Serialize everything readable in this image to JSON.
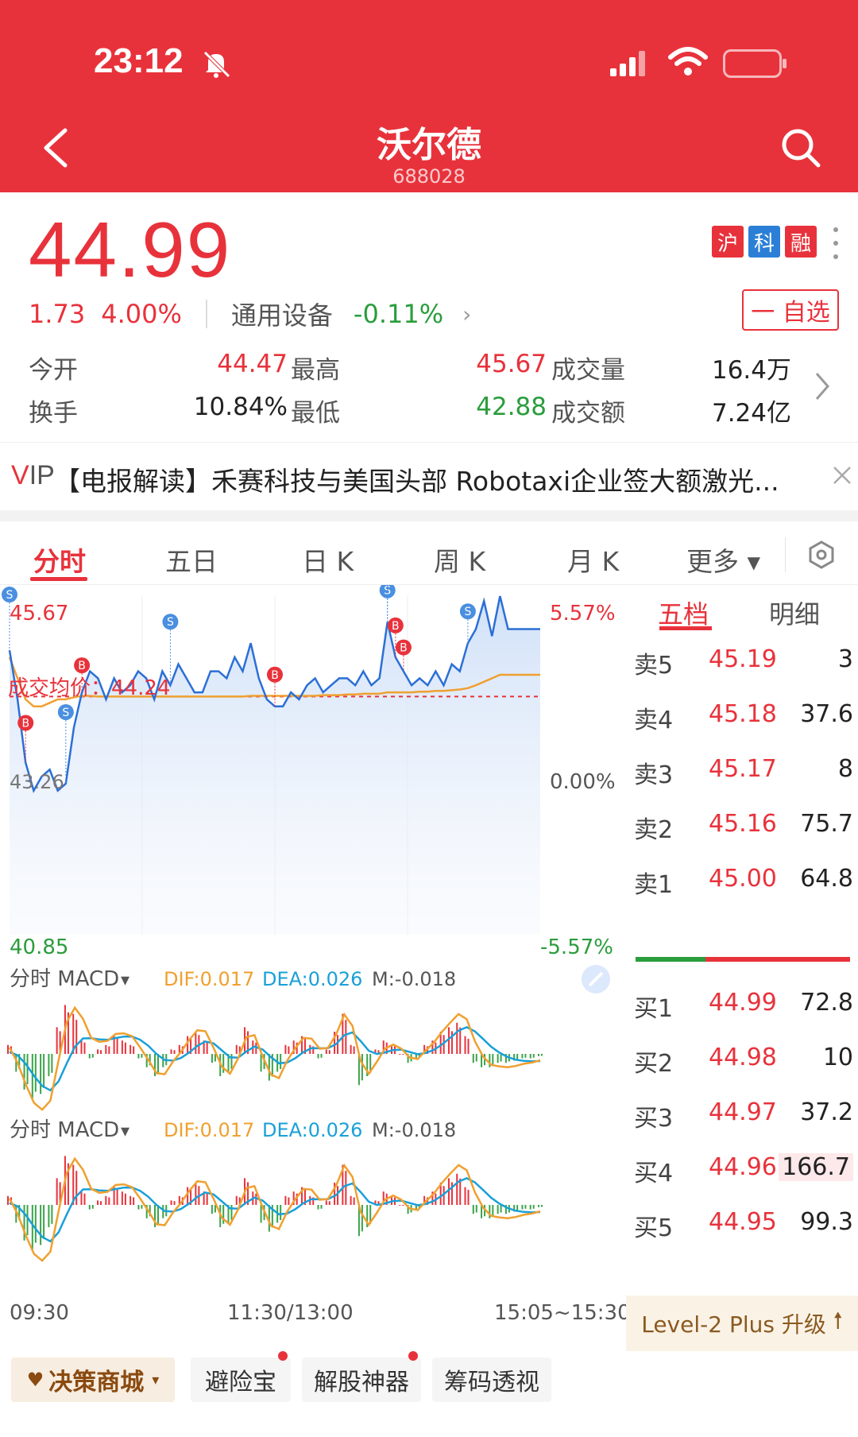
{
  "status_bar": {
    "time": "23:12"
  },
  "header": {
    "title": "沃尔德",
    "code": "688028"
  },
  "quote": {
    "price": "44.99",
    "change": "1.73",
    "change_pct": "4.00%",
    "badges": [
      "沪",
      "科",
      "融"
    ],
    "sector": "通用设备",
    "sector_change": "-0.11%",
    "watch_button": "一 自选"
  },
  "stats": [
    [
      {
        "label": "今开",
        "value": "44.47"
      },
      {
        "label": "最高",
        "value": "45.67"
      },
      {
        "label": "成交量",
        "value": "16.4万"
      }
    ],
    [
      {
        "label": "换手",
        "value": "10.84%"
      },
      {
        "label": "最低",
        "value": "42.88"
      },
      {
        "label": "成交额",
        "value": "7.24亿"
      }
    ]
  ],
  "news": {
    "prefix_v": "V",
    "prefix_ip": "IP",
    "text": "【电报解读】禾赛科技与美国头部 Robotaxi企业签大额激光..."
  },
  "tabs": [
    "分时",
    "五日",
    "日 K",
    "周 K",
    "月 K",
    "更多"
  ],
  "chart": {
    "price_high": "45.67",
    "price_low": "40.85",
    "pct_high": "5.57%",
    "pct_zero": "0.00%",
    "pct_low": "-5.57%",
    "prev_close_label": "43.26",
    "avg_label": "成交均价：44.24",
    "macd_title": "分时 MACD",
    "dif": "DIF:0.017",
    "dea": "DEA:0.026",
    "m": "M:-0.018",
    "time_start": "09:30",
    "time_mid": "11:30/13:00",
    "time_end": "15:05~15:30",
    "buy_marker": "B",
    "sell_marker": "S"
  },
  "chart_data": {
    "type": "line",
    "title": "分时",
    "ylim": [
      40.85,
      45.67
    ],
    "y_pct_range": [
      "-5.57%",
      "5.57%"
    ],
    "x_ticks": [
      "09:30",
      "11:30/13:00",
      "15:05~15:30"
    ],
    "series": [
      {
        "name": "price",
        "values": [
          44.9,
          44.2,
          43.3,
          42.9,
          43.1,
          43.2,
          42.9,
          43.0,
          43.8,
          44.3,
          44.6,
          44.5,
          44.2,
          44.5,
          44.3,
          44.4,
          44.6,
          44.5,
          44.2,
          44.6,
          44.4,
          44.7,
          44.5,
          44.3,
          44.3,
          44.6,
          44.6,
          44.5,
          44.8,
          44.6,
          45.0,
          44.5,
          44.2,
          44.1,
          44.1,
          44.3,
          44.2,
          44.4,
          44.5,
          44.3,
          44.4,
          44.5,
          44.5,
          44.4,
          44.6,
          44.4,
          44.5,
          45.3,
          44.8,
          44.6,
          44.4,
          44.5,
          44.4,
          44.6,
          44.4,
          44.7,
          44.6,
          45.0,
          45.2,
          45.6,
          45.1,
          45.67,
          45.2,
          45.2,
          45.2,
          45.2,
          45.2
        ]
      },
      {
        "name": "成交均价",
        "values": [
          44.8,
          44.5,
          44.2,
          44.1,
          44.1,
          44.15,
          44.2,
          44.2,
          44.23,
          44.25,
          44.25,
          44.24,
          44.24,
          44.24,
          44.24,
          44.24,
          44.24,
          44.24,
          44.24,
          44.24,
          44.24,
          44.24,
          44.24,
          44.24,
          44.24,
          44.24,
          44.24,
          44.24,
          44.24,
          44.24,
          44.25,
          44.25,
          44.25,
          44.25,
          44.25,
          44.25,
          44.25,
          44.25,
          44.25,
          44.26,
          44.26,
          44.26,
          44.27,
          44.27,
          44.28,
          44.28,
          44.28,
          44.3,
          44.3,
          44.3,
          44.3,
          44.31,
          44.31,
          44.32,
          44.32,
          44.33,
          44.34,
          44.36,
          44.4,
          44.45,
          44.5,
          44.55,
          44.55,
          44.55,
          44.55,
          44.55,
          44.55
        ]
      }
    ],
    "macd": {
      "dif": 0.017,
      "dea": 0.026,
      "m": -0.018,
      "bars": [
        0.2,
        -0.4,
        -0.8,
        -1.0,
        -0.9,
        -0.5,
        0.6,
        1.1,
        0.9,
        0.3,
        -0.1,
        0.1,
        0.2,
        0.4,
        0.3,
        0.2,
        -0.1,
        -0.3,
        -0.5,
        -0.3,
        0.1,
        0.2,
        0.4,
        0.5,
        0.3,
        -0.2,
        -0.5,
        -0.4,
        0.2,
        0.6,
        0.3,
        -0.4,
        -0.6,
        -0.4,
        0.2,
        0.3,
        0.4,
        0.2,
        -0.1,
        0.1,
        0.5,
        0.9,
        0.2,
        -0.7,
        -0.5,
        0.1,
        0.3,
        0.2,
        0.0,
        -0.2,
        -0.1,
        0.2,
        0.3,
        0.5,
        0.6,
        0.7,
        0.4,
        -0.2,
        -0.3,
        -0.3,
        -0.2,
        -0.2,
        -0.15,
        -0.1,
        -0.1,
        -0.05
      ]
    }
  },
  "order_book": {
    "tabs": [
      "五档",
      "明细"
    ],
    "sell": [
      {
        "name": "卖5",
        "price": "45.19",
        "vol": "3"
      },
      {
        "name": "卖4",
        "price": "45.18",
        "vol": "37.6"
      },
      {
        "name": "卖3",
        "price": "45.17",
        "vol": "8"
      },
      {
        "name": "卖2",
        "price": "45.16",
        "vol": "75.7"
      },
      {
        "name": "卖1",
        "price": "45.00",
        "vol": "64.8"
      }
    ],
    "buy": [
      {
        "name": "买1",
        "price": "44.99",
        "vol": "72.8"
      },
      {
        "name": "买2",
        "price": "44.98",
        "vol": "10"
      },
      {
        "name": "买3",
        "price": "44.97",
        "vol": "37.2"
      },
      {
        "name": "买4",
        "price": "44.96",
        "vol": "166.7"
      },
      {
        "name": "买5",
        "price": "44.95",
        "vol": "99.3"
      }
    ],
    "level2": "Level-2 Plus 升级"
  },
  "bottom_buttons": [
    "决策商城",
    "避险宝",
    "解股神器",
    "筹码透视"
  ],
  "colors": {
    "brand_red": "#e8323b",
    "down_green": "#2a9d3c",
    "price_line": "#2b6fd6",
    "avg_line": "#f0a030",
    "dif_line": "#f0a030",
    "dea_line": "#1aa0d8"
  }
}
